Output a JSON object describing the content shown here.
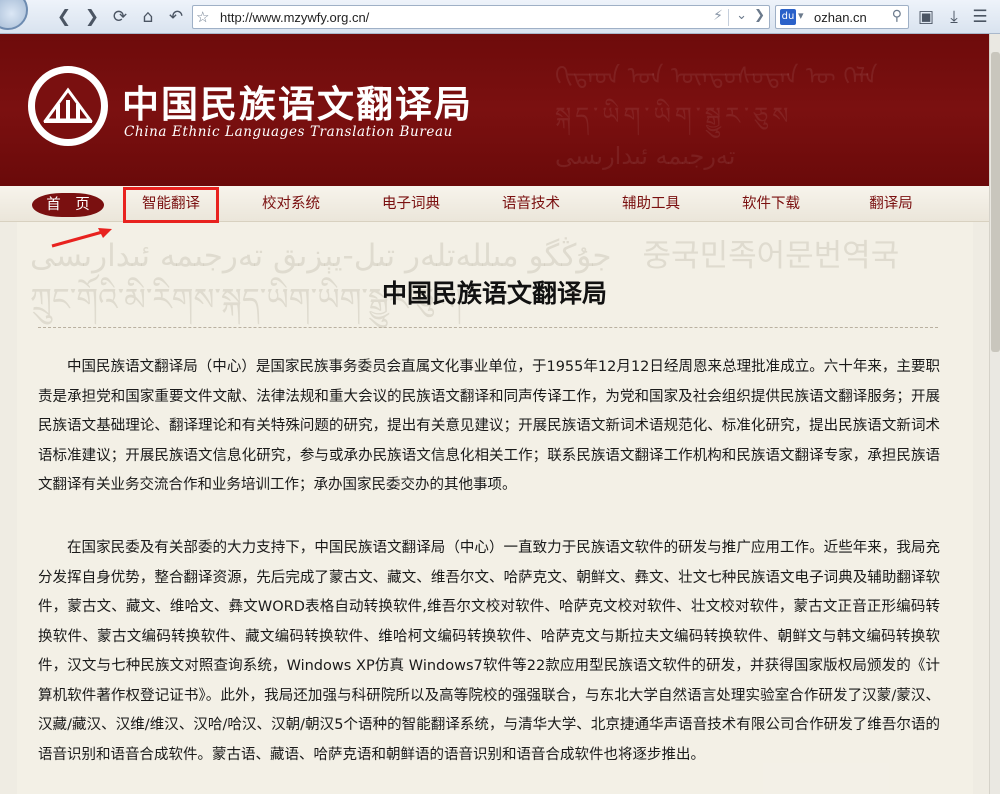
{
  "browser": {
    "url": "http://www.mzywfy.org.cn/",
    "search_query": "ozhan.cn",
    "search_engine_label": "du"
  },
  "site": {
    "name_cn": "中国民族语文翻译局",
    "name_en": "China Ethnic Languages Translation Bureau",
    "brand_color": "#7a1010"
  },
  "nav": {
    "home": "首　页",
    "items": [
      "智能翻译",
      "校对系统",
      "电子词典",
      "语音技术",
      "辅助工具",
      "软件下载",
      "翻译局"
    ]
  },
  "annotation": {
    "highlight_color": "#e8221f"
  },
  "watermark": {
    "line1": "جۇڭگو مىللەتلەر تىل-يېزىق تەرجىمە ئىدارىسى　중국민족어문번역국",
    "line2": "ཀྲུང་གོའི་མི་རིགས་སྐད་ཡིག་ཡིག་སྒྱུར་ཅུས།"
  },
  "content": {
    "title": "中国民族语文翻译局",
    "paragraphs": [
      "中国民族语文翻译局（中心）是国家民族事务委员会直属文化事业单位，于1955年12月12日经周恩来总理批准成立。六十年来，主要职责是承担党和国家重要文件文献、法律法规和重大会议的民族语文翻译和同声传译工作，为党和国家及社会组织提供民族语文翻译服务；开展民族语文基础理论、翻译理论和有关特殊问题的研究，提出有关意见建议；开展民族语文新词术语规范化、标准化研究，提出民族语文新词术语标准建议；开展民族语文信息化研究，参与或承办民族语文信息化相关工作；联系民族语文翻译工作机构和民族语文翻译专家，承担民族语文翻译有关业务交流合作和业务培训工作；承办国家民委交办的其他事项。",
      "在国家民委及有关部委的大力支持下，中国民族语文翻译局（中心）一直致力于民族语文软件的研发与推广应用工作。近些年来，我局充分发挥自身优势，整合翻译资源，先后完成了蒙古文、藏文、维吾尔文、哈萨克文、朝鲜文、彝文、壮文七种民族语文电子词典及辅助翻译软件，蒙古文、藏文、维哈文、彝文WORD表格自动转换软件,维吾尔文校对软件、哈萨克文校对软件、壮文校对软件，蒙古文正音正形编码转换软件、蒙古文编码转换软件、藏文编码转换软件、维哈柯文编码转换软件、哈萨克文与斯拉夫文编码转换软件、朝鲜文与韩文编码转换软件，汉文与七种民族文对照查询系统，Windows XP仿真 Windows7软件等22款应用型民族语文软件的研发，并获得国家版权局颁发的《计算机软件著作权登记证书》。此外，我局还加强与科研院所以及高等院校的强强联合，与东北大学自然语言处理实验室合作研发了汉蒙/蒙汉、汉藏/藏汉、汉维/维汉、汉哈/哈汉、汉朝/朝汉5个语种的智能翻译系统，与清华大学、北京捷通华声语音技术有限公司合作研发了维吾尔语的语音识别和语音合成软件。蒙古语、藏语、哈萨克语和朝鲜语的语音识别和语音合成软件也将逐步推出。"
    ]
  }
}
